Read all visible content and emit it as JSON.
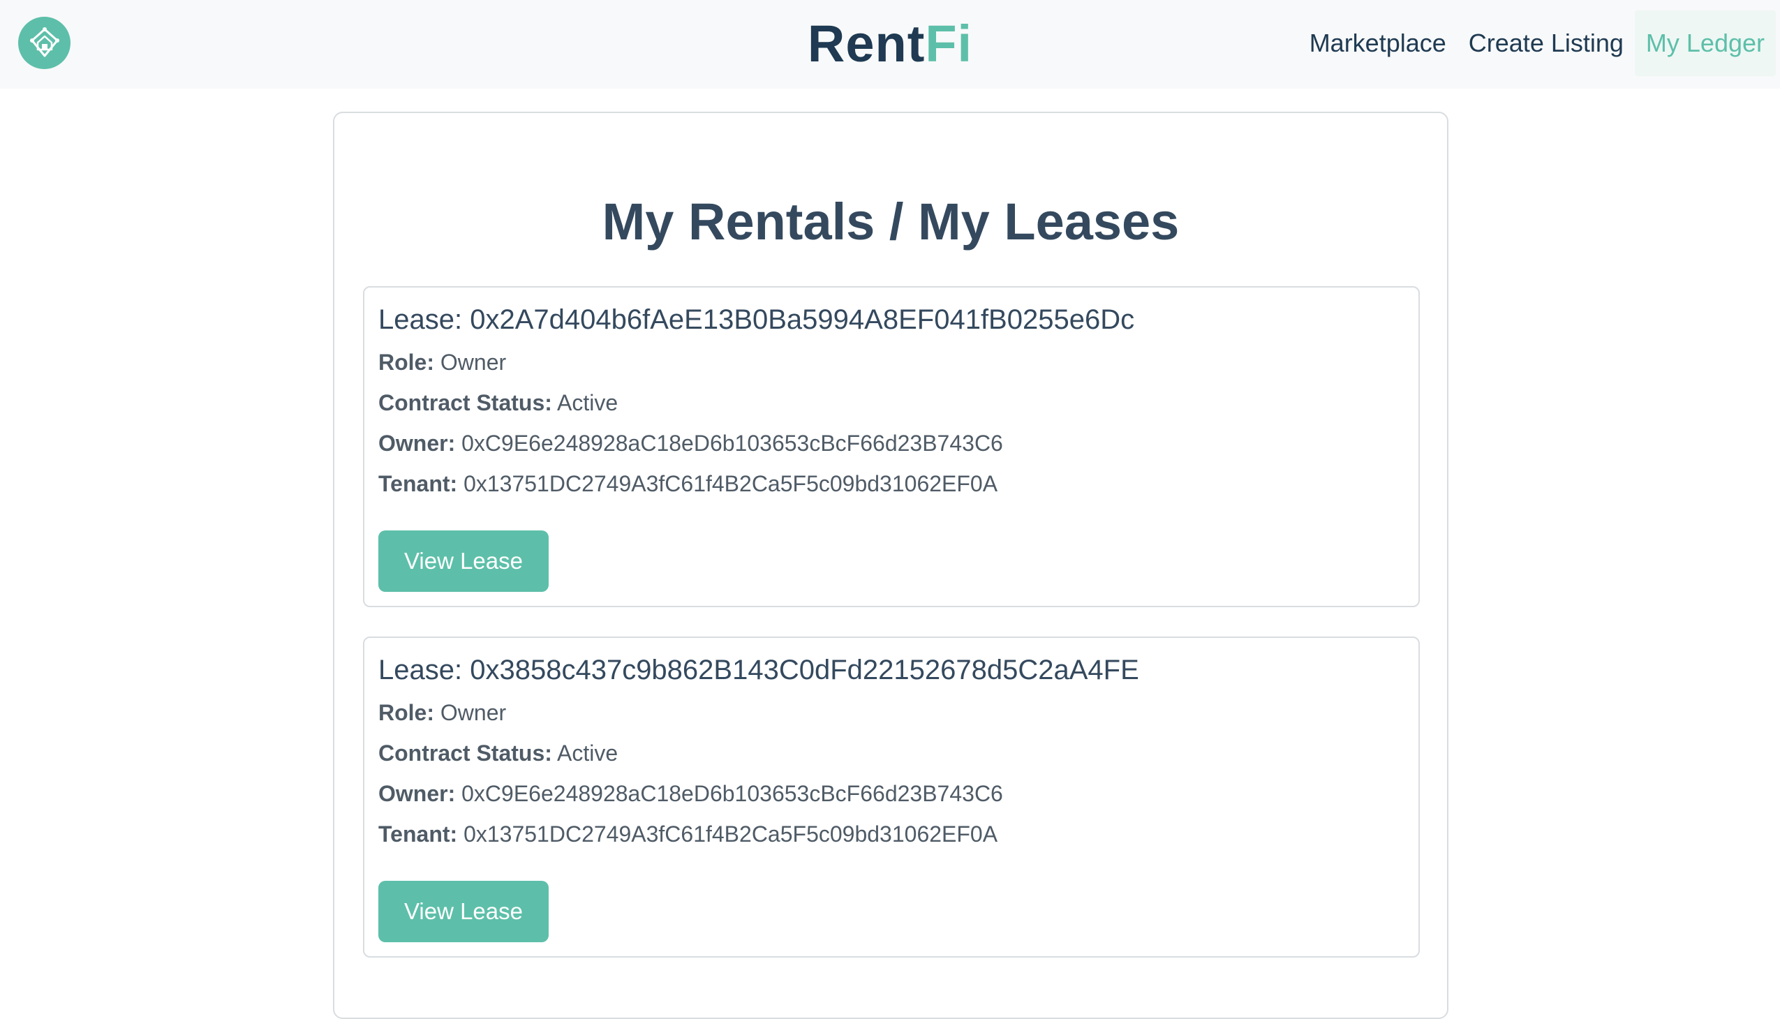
{
  "header": {
    "brand_part1": "Rent",
    "brand_part2": "Fi",
    "logo_icon": "house-shield-icon",
    "nav": [
      {
        "label": "Marketplace",
        "active": false
      },
      {
        "label": "Create Listing",
        "active": false
      },
      {
        "label": "My Ledger",
        "active": true
      }
    ]
  },
  "main": {
    "title": "My Rentals / My Leases",
    "leases": [
      {
        "title_prefix": "Lease: ",
        "address": "0x2A7d404b6fAeE13B0Ba5994A8EF041fB0255e6Dc",
        "role_label": "Role:",
        "role": "Owner",
        "status_label": "Contract Status:",
        "status": "Active",
        "owner_label": "Owner:",
        "owner": "0xC9E6e248928aC18eD6b103653cBcF66d23B743C6",
        "tenant_label": "Tenant:",
        "tenant": "0x13751DC2749A3fC61f4B2Ca5F5c09bd31062EF0A",
        "button_label": "View Lease"
      },
      {
        "title_prefix": "Lease: ",
        "address": "0x3858c437c9b862B143C0dFd22152678d5C2aA4FE",
        "role_label": "Role:",
        "role": "Owner",
        "status_label": "Contract Status:",
        "status": "Active",
        "owner_label": "Owner:",
        "owner": "0xC9E6e248928aC18eD6b103653cBcF66d23B743C6",
        "tenant_label": "Tenant:",
        "tenant": "0x13751DC2749A3fC61f4B2Ca5F5c09bd31062EF0A",
        "button_label": "View Lease"
      }
    ]
  },
  "colors": {
    "accent": "#5dbfa9",
    "brand_dark": "#1f3a52",
    "text": "#34495e"
  }
}
